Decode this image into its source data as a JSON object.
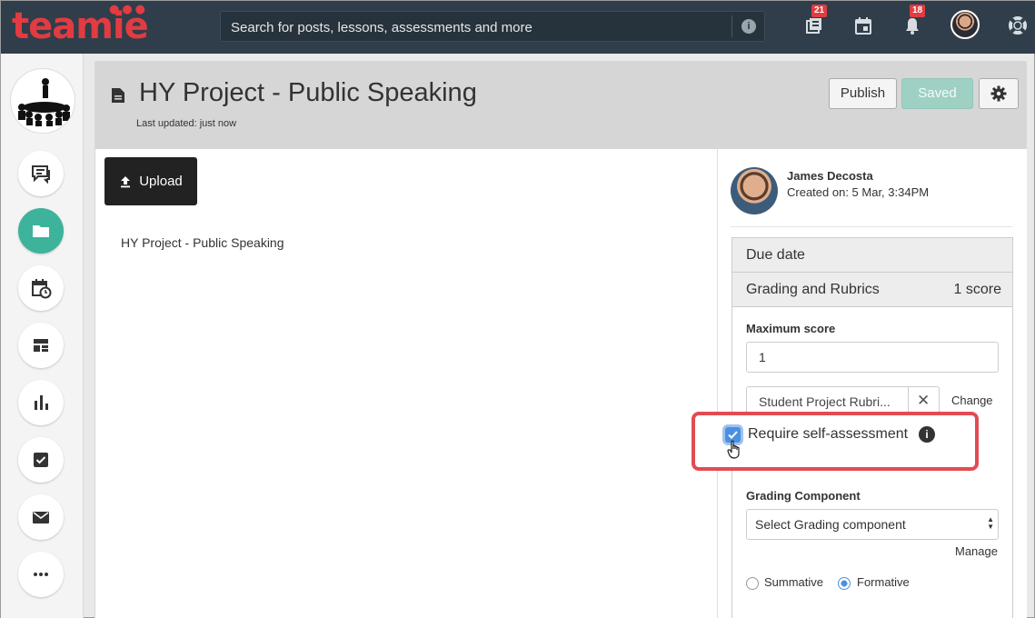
{
  "app": {
    "logo_text": "teamie",
    "brand_color": "#e23b41"
  },
  "topbar": {
    "search_placeholder": "Search for posts, lessons, assessments and more",
    "search_info_icon": "i",
    "icons": [
      "library-icon",
      "calendar-icon",
      "bell-icon",
      "avatar",
      "help-icon"
    ],
    "library_badge": "21",
    "notifications_badge": "18"
  },
  "sidebar": {
    "items": [
      "messages-icon",
      "folder-icon",
      "schedule-icon",
      "dashboard-icon",
      "analytics-icon",
      "tasks-icon",
      "mail-icon",
      "more-icon"
    ],
    "active_item": "folder-icon",
    "active_color": "#3db39c"
  },
  "header": {
    "title": "HY Project - Public Speaking",
    "last_updated": "Last updated: just now",
    "publish_label": "Publish",
    "saved_label": "Saved"
  },
  "content": {
    "upload_label": "Upload",
    "body_text": "HY Project - Public Speaking"
  },
  "author": {
    "name": "James Decosta",
    "created": "Created on: 5 Mar, 3:34PM"
  },
  "settings": {
    "due_date_label": "Due date",
    "grading_label": "Grading and Rubrics",
    "grading_count": "1 score",
    "max_score_label": "Maximum score",
    "max_score_value": "1",
    "rubric_name": "Student Project Rubri...",
    "rubric_remove": "✕",
    "change_label": "Change",
    "self_assessment_label": "Require self-assessment",
    "self_assessment_checked": true,
    "self_assessment_info": "i",
    "grading_component_label": "Grading Component",
    "grading_component_value": "Select Grading component",
    "manage_label": "Manage",
    "summative_label": "Summative",
    "formative_label": "Formative",
    "selected_type": "Formative"
  }
}
